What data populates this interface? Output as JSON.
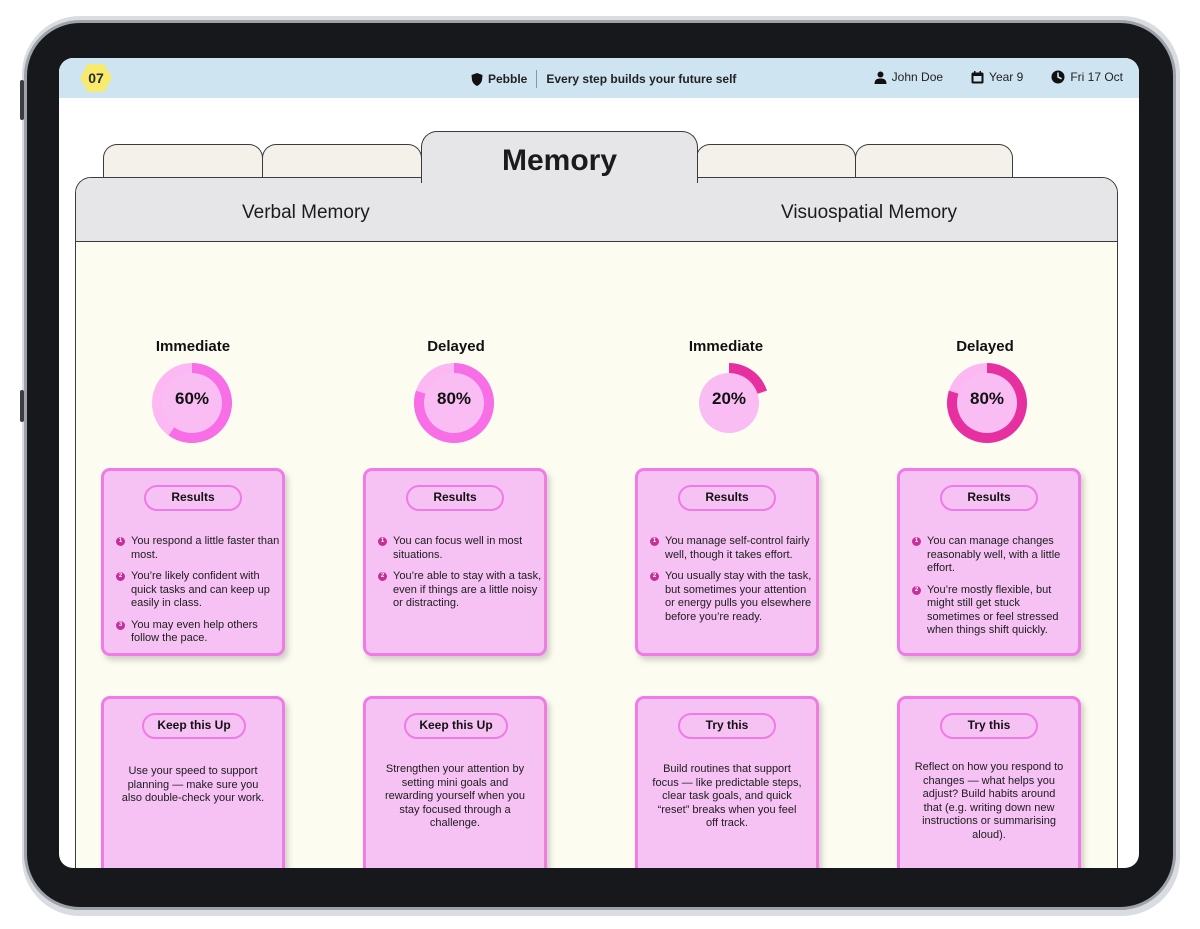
{
  "header": {
    "badge": "07",
    "brand": "Pebble",
    "tagline": "Every step builds your future self",
    "user": "John Doe",
    "year": "Year 9",
    "date": "Fri 17 Oct"
  },
  "tabs": {
    "active": "Memory"
  },
  "sections": {
    "left": "Verbal Memory",
    "right": "Visuospatial Memory"
  },
  "colors": {
    "ring_light": "#f76ee6",
    "ring_dark": "#e6309f",
    "card_fill": "#f6c2f4",
    "card_border": "#f07ae6"
  },
  "columns": [
    {
      "title": "Immediate",
      "percent": 60,
      "percent_label": "60%",
      "results_label": "Results",
      "results": [
        "You respond a little faster than most.",
        "You’re likely confident with quick tasks and can keep up easily in class.",
        "You may even help others follow the pace."
      ],
      "tip_label": "Keep this Up",
      "tip": "Use your speed to support planning — make sure you also double-check your work."
    },
    {
      "title": "Delayed",
      "percent": 80,
      "percent_label": "80%",
      "results_label": "Results",
      "results": [
        "You can focus well in most situations.",
        "You’re able to stay with a task, even if things are a little noisy or distracting."
      ],
      "tip_label": "Keep this Up",
      "tip": "Strengthen your attention by setting mini goals and rewarding yourself when you stay focused through a challenge."
    },
    {
      "title": "Immediate",
      "percent": 20,
      "percent_label": "20%",
      "results_label": "Results",
      "results": [
        "You manage self-control fairly well, though it takes effort.",
        "You usually stay with the task, but sometimes your attention or energy pulls you elsewhere before you’re ready."
      ],
      "tip_label": "Try this",
      "tip": "Build routines that support focus — like predictable steps, clear task goals, and quick “reset” breaks when you feel off track."
    },
    {
      "title": "Delayed",
      "percent": 80,
      "percent_label": "80%",
      "results_label": "Results",
      "results": [
        "You can manage changes reasonably well, with a little effort.",
        "You’re mostly flexible, but might still get stuck sometimes or feel stressed when things shift quickly."
      ],
      "tip_label": "Try this",
      "tip": "Reflect on how you respond to changes — what helps you adjust? Build habits around that (e.g. writing down new instructions or summarising aloud)."
    }
  ]
}
